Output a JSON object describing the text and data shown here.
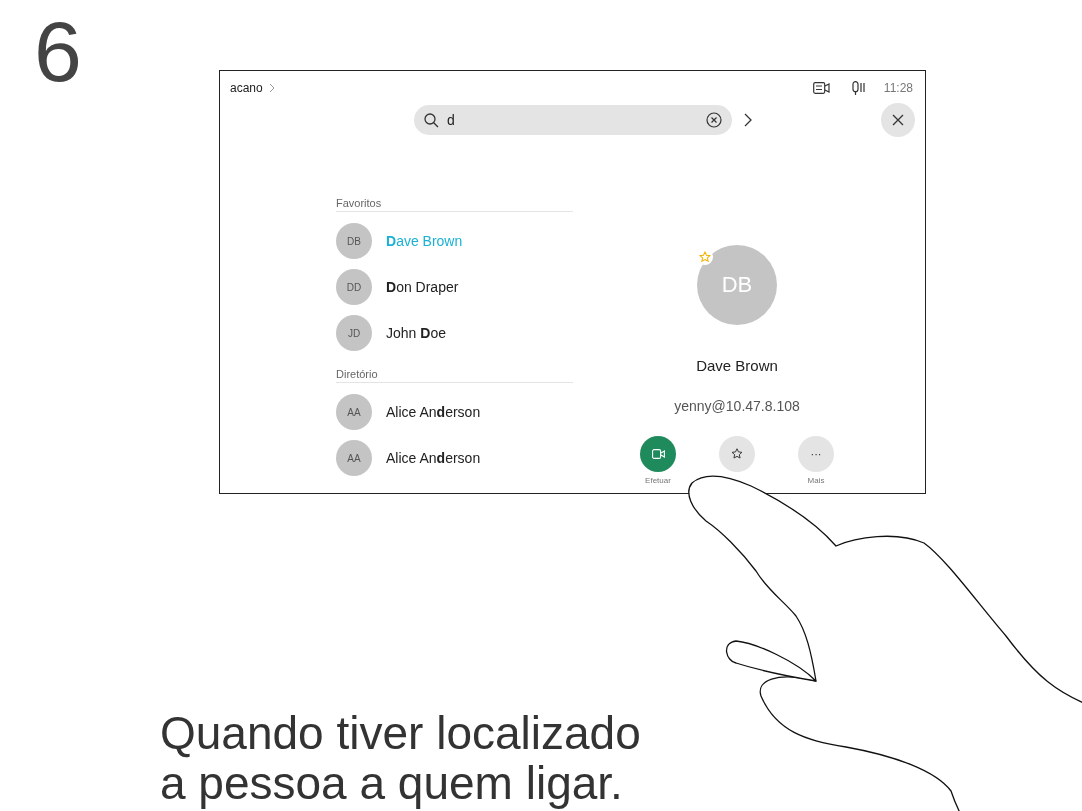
{
  "step": "6",
  "screen": {
    "breadcrumb": "acano",
    "time": "11:28",
    "search": {
      "value": "d"
    },
    "sections": [
      {
        "title": "Favoritos",
        "contacts": [
          {
            "initials": "DB",
            "name": "**D**ave Brown",
            "selected": true
          },
          {
            "initials": "DD",
            "name": "**D**on Draper",
            "selected": false
          },
          {
            "initials": "JD",
            "name": "John **D**oe",
            "selected": false
          }
        ]
      },
      {
        "title": "Diretório",
        "contacts": [
          {
            "initials": "AA",
            "name": "Alice An**d**erson",
            "selected": false
          },
          {
            "initials": "AA",
            "name": "Alice An**d**erson",
            "selected": false
          }
        ]
      }
    ],
    "details": {
      "initials": "DB",
      "favorite": true,
      "name": "Dave Brown",
      "address": "yenny@10.47.8.108",
      "actions": [
        {
          "kind": "call",
          "label": "Efetuar"
        },
        {
          "kind": "favorite"
        },
        {
          "kind": "more",
          "glyph": "···",
          "label": "Mais"
        }
      ]
    }
  },
  "caption": [
    "Quando tiver localizado",
    "a pessoa a quem ligar."
  ]
}
